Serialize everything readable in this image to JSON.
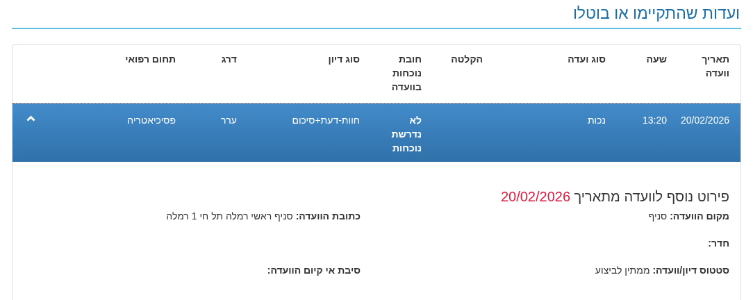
{
  "title": "ועדות שהתקיימו או בוטלו",
  "table": {
    "columns": [
      "תאריך וועדה",
      "שעה",
      "סוג ועדה",
      "הקלטה",
      "חובת נוכחות בוועדה",
      "סוג דיון",
      "דרג",
      "תחום רפואי"
    ],
    "rows": [
      {
        "selected": true,
        "expanded": true,
        "cells": [
          "20/02/2026",
          "13:20",
          "נכות",
          null,
          "לא נדרשת נוכחות",
          "חוות-דעת+סיכום",
          "ערר",
          "פסיכיאטריה"
        ]
      }
    ]
  },
  "details": {
    "heading": "פירוט נוסף לוועדה מתאריך",
    "date": "20/02/2026",
    "field_rows": [
      [
        {
          "label": "מקום הוועדה:",
          "value": "סניף"
        },
        {
          "label": "כתובת הוועדה:",
          "value": "סניף ראשי רמלה תל חי 1 רמלה"
        }
      ],
      [
        {
          "label": "חדר:"
        }
      ],
      [
        {
          "label": "סטטוס דיון/וועדה:",
          "value": "ממתין לביצוע"
        },
        {
          "label": "סיבת אי קיום הוועדה:"
        }
      ]
    ]
  }
}
